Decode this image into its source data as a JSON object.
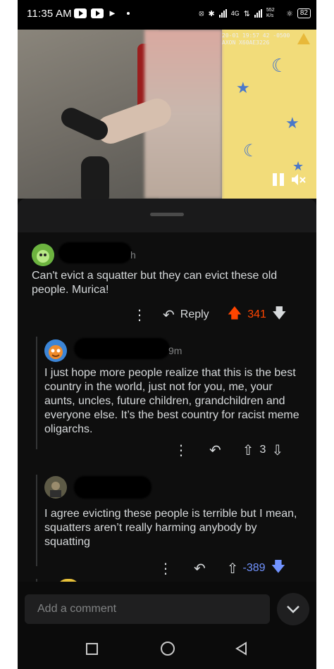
{
  "status_bar": {
    "time": "11:35 AM",
    "net_speed": "552 K/s",
    "network": "4G",
    "battery": "82"
  },
  "video": {
    "timestamp_line1": "20-01 19:57 42 -0500",
    "timestamp_line2": "AXON X60AE3226"
  },
  "sheet": {},
  "comments": [
    {
      "age": "h",
      "text": "Can't evict a squatter but they can evict these old people. Murica!",
      "reply_label": "Reply",
      "votes": "341",
      "vote_color": "#ff4500"
    },
    {
      "age": "9m",
      "text": "I just hope more people realize that this is the best country in the world, just not for you, me, your aunts, uncles, future children, grandchildren and everyone else. It’s the best country for racist meme oligarchs.",
      "votes": "3"
    },
    {
      "text": "I agree evicting these people is terrible but I mean, squatters aren’t really harming anybody by squatting",
      "votes": "-389",
      "vote_color": "#7193ff"
    }
  ],
  "composer": {
    "placeholder": "Add a comment"
  },
  "icons": {
    "more": "more-vertical-icon",
    "reply": "reply-arrow-icon",
    "upvote": "upvote-arrow-icon",
    "downvote": "downvote-arrow-icon",
    "collapse": "chevron-down-icon"
  }
}
